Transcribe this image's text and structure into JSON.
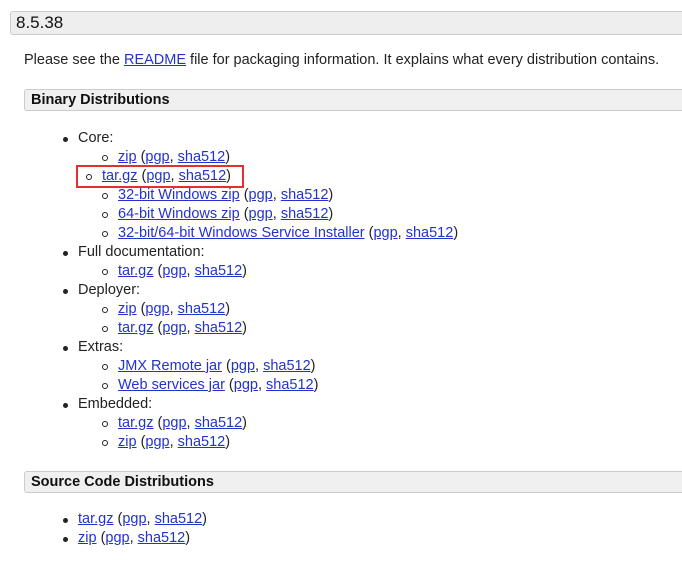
{
  "version_title": "8.5.38",
  "intro": {
    "before": "Please see the ",
    "link": "README",
    "after": " file for packaging information. It explains what every distribution contains."
  },
  "binary": {
    "title": "Binary Distributions",
    "groups": [
      {
        "label": "Core:",
        "items": [
          {
            "name": "zip",
            "pgp": "pgp",
            "sha": "sha512"
          },
          {
            "name": "tar.gz",
            "pgp": "pgp",
            "sha": "sha512",
            "highlighted": true
          },
          {
            "name": "32-bit Windows zip",
            "pgp": "pgp",
            "sha": "sha512"
          },
          {
            "name": "64-bit Windows zip",
            "pgp": "pgp",
            "sha": "sha512"
          },
          {
            "name": "32-bit/64-bit Windows Service Installer",
            "pgp": "pgp",
            "sha": "sha512"
          }
        ]
      },
      {
        "label": "Full documentation:",
        "items": [
          {
            "name": "tar.gz",
            "pgp": "pgp",
            "sha": "sha512"
          }
        ]
      },
      {
        "label": "Deployer:",
        "items": [
          {
            "name": "zip",
            "pgp": "pgp",
            "sha": "sha512"
          },
          {
            "name": "tar.gz",
            "pgp": "pgp",
            "sha": "sha512"
          }
        ]
      },
      {
        "label": "Extras:",
        "items": [
          {
            "name": "JMX Remote jar",
            "pgp": "pgp",
            "sha": "sha512"
          },
          {
            "name": "Web services jar",
            "pgp": "pgp",
            "sha": "sha512"
          }
        ]
      },
      {
        "label": "Embedded:",
        "items": [
          {
            "name": "tar.gz",
            "pgp": "pgp",
            "sha": "sha512"
          },
          {
            "name": "zip",
            "pgp": "pgp",
            "sha": "sha512"
          }
        ]
      }
    ]
  },
  "source": {
    "title": "Source Code Distributions",
    "items": [
      {
        "name": "tar.gz",
        "pgp": "pgp",
        "sha": "sha512"
      },
      {
        "name": "zip",
        "pgp": "pgp",
        "sha": "sha512"
      }
    ]
  },
  "punct": {
    "open": " (",
    "sep": ", ",
    "close": ")"
  },
  "colors": {
    "link": "#2233cc",
    "highlight": "#e03030"
  }
}
